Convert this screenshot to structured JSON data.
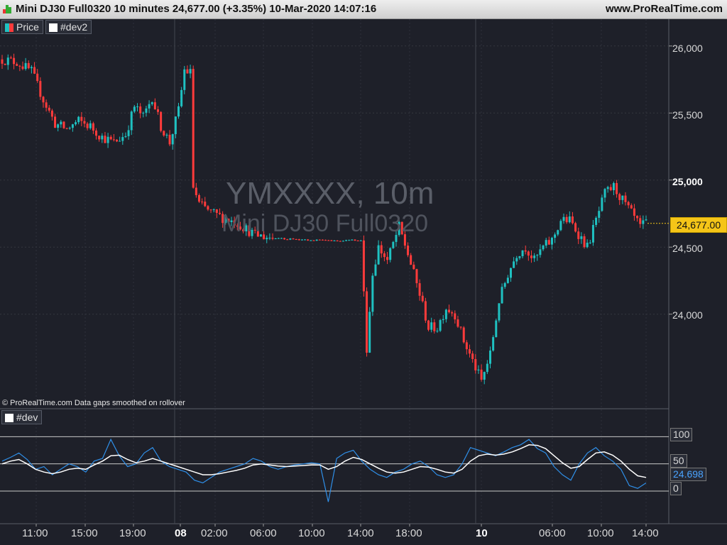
{
  "window": {
    "title": "Mini DJ30 Full0320 10 minutes 24,677.00 (+3.35%) 10-Mar-2020 14:07:16",
    "brand": "www.ProRealTime.com"
  },
  "price_panel": {
    "legend_price": "Price",
    "legend_dev2": "#dev2",
    "watermark_symbol": "YMXXXX, 10m",
    "watermark_name": "Mini DJ30 Full0320",
    "current_price": "24,677.00",
    "note": "© ProRealTime.com  Data gaps smoothed on rollover",
    "y_labels": [
      "26,000",
      "25,500",
      "25,000",
      "24,500",
      "24,000"
    ]
  },
  "oscillator_panel": {
    "legend": "#dev",
    "levels": [
      "100",
      "50",
      "0"
    ],
    "current_value": "24.698"
  },
  "time_axis": {
    "labels": [
      "11:00",
      "15:00",
      "19:00",
      "08",
      "02:00",
      "06:00",
      "10:00",
      "14:00",
      "18:00",
      "10",
      "06:00",
      "10:00",
      "14:00"
    ]
  },
  "colors": {
    "background": "#1e2029",
    "candle_up": "#1fc1c1",
    "candle_down": "#ff3b3b",
    "osc_fast": "#2f8fe8",
    "osc_slow": "#ffffff",
    "price_tag": "#f5c518"
  },
  "chart_data": {
    "type": "candlestick",
    "series": [
      {
        "name": "Price",
        "close_path": [
          [
            0,
            25900
          ],
          [
            5,
            25880
          ],
          [
            10,
            25810
          ],
          [
            14,
            25600
          ],
          [
            18,
            25420
          ],
          [
            22,
            25380
          ],
          [
            26,
            25440
          ],
          [
            30,
            25400
          ],
          [
            34,
            25320
          ],
          [
            38,
            25280
          ],
          [
            42,
            25340
          ],
          [
            45,
            25550
          ],
          [
            48,
            25470
          ],
          [
            51,
            25620
          ],
          [
            54,
            25400
          ],
          [
            57,
            25280
          ],
          [
            60,
            25520
          ],
          [
            62,
            25820
          ],
          [
            64,
            25800
          ],
          [
            65,
            24950
          ],
          [
            67,
            24820
          ],
          [
            71,
            24760
          ],
          [
            75,
            24720
          ],
          [
            80,
            24680
          ],
          [
            86,
            24590
          ],
          [
            92,
            24570
          ],
          [
            98,
            24560
          ],
          [
            104,
            24555
          ],
          [
            110,
            24550
          ],
          [
            118,
            24550
          ],
          [
            122,
            24550
          ],
          [
            124,
            23750
          ],
          [
            126,
            24300
          ],
          [
            128,
            24500
          ],
          [
            131,
            24400
          ],
          [
            135,
            24650
          ],
          [
            138,
            24450
          ],
          [
            142,
            24150
          ],
          [
            145,
            23900
          ],
          [
            148,
            23900
          ],
          [
            151,
            24050
          ],
          [
            154,
            24000
          ],
          [
            157,
            23800
          ],
          [
            160,
            23650
          ],
          [
            163,
            23500
          ],
          [
            166,
            23700
          ],
          [
            169,
            24100
          ],
          [
            172,
            24300
          ],
          [
            175,
            24450
          ],
          [
            178,
            24500
          ],
          [
            181,
            24400
          ],
          [
            184,
            24500
          ],
          [
            187,
            24550
          ],
          [
            190,
            24700
          ],
          [
            193,
            24700
          ],
          [
            196,
            24600
          ],
          [
            199,
            24500
          ],
          [
            202,
            24700
          ],
          [
            205,
            24900
          ],
          [
            208,
            24950
          ],
          [
            211,
            24850
          ],
          [
            214,
            24750
          ],
          [
            217,
            24650
          ],
          [
            219,
            24677
          ]
        ],
        "last_close": 24677.0,
        "change_pct": 3.35
      },
      {
        "name": "#dev",
        "fast_values": [
          55,
          62,
          70,
          58,
          40,
          45,
          30,
          40,
          50,
          45,
          35,
          55,
          60,
          95,
          65,
          45,
          50,
          70,
          80,
          55,
          45,
          40,
          35,
          20,
          15,
          25,
          35,
          40,
          45,
          50,
          60,
          55,
          45,
          40,
          45,
          48,
          50,
          52,
          50,
          -20,
          60,
          70,
          75,
          55,
          40,
          30,
          25,
          35,
          40,
          50,
          55,
          45,
          30,
          25,
          30,
          50,
          80,
          75,
          70,
          65,
          72,
          80,
          85,
          95,
          78,
          70,
          45,
          30,
          20,
          50,
          70,
          80,
          65,
          55,
          40,
          10,
          5,
          15
        ],
        "slow_values": [
          50,
          55,
          58,
          50,
          40,
          35,
          32,
          35,
          40,
          42,
          40,
          48,
          55,
          65,
          66,
          58,
          52,
          55,
          60,
          55,
          50,
          45,
          40,
          35,
          30,
          30,
          32,
          35,
          38,
          42,
          48,
          50,
          48,
          46,
          45,
          46,
          47,
          48,
          48,
          40,
          45,
          55,
          62,
          58,
          50,
          42,
          35,
          33,
          35,
          40,
          45,
          44,
          40,
          35,
          33,
          40,
          55,
          65,
          68,
          66,
          68,
          72,
          78,
          85,
          84,
          78,
          65,
          52,
          42,
          45,
          58,
          70,
          72,
          66,
          55,
          40,
          28,
          25
        ],
        "current_value": 24.698
      }
    ],
    "ylim_price": [
      23300,
      26200
    ],
    "ylim_osc": [
      -60,
      150
    ],
    "levels_osc": [
      0,
      50,
      100
    ],
    "grid": true,
    "legend_placement": "top-left"
  }
}
